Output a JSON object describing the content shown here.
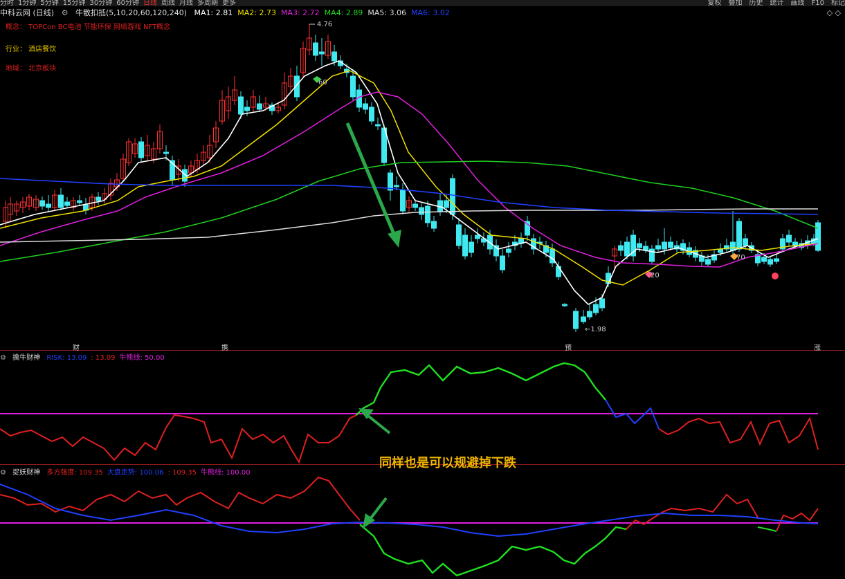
{
  "topbar": {
    "tabs": [
      "分时",
      "1分钟",
      "5分钟",
      "15分钟",
      "30分钟",
      "60分钟",
      "日线",
      "周线",
      "月线",
      "多周期",
      "更多"
    ],
    "active": "日线",
    "right": [
      "复权",
      "叠加",
      "历史",
      "统计",
      "画线",
      "F10",
      "标记"
    ]
  },
  "header": {
    "stock": "中科云网 (日线)",
    "indicator": "牛散扣抵(5,10,20,60,120,240)",
    "ma": [
      {
        "label": "MA1: 2.81",
        "color": "#ffffff"
      },
      {
        "label": "MA2: 2.73",
        "color": "#f0e000"
      },
      {
        "label": "MA3: 2.72",
        "color": "#e020e0"
      },
      {
        "label": "MA4: 2.89",
        "color": "#20d020"
      },
      {
        "label": "MA5: 3.06",
        "color": "#dddddd"
      },
      {
        "label": "MA6: 3.02",
        "color": "#2040ff"
      }
    ]
  },
  "info": {
    "concept": "概念： TOPCon BC电池 节能环保 网络游戏 NFT概念",
    "industry": "行业： 酒店餐饮",
    "region": "地域： 北京板块"
  },
  "price_labels": {
    "high": "4.76",
    "low": "1.98"
  },
  "annotations": {
    "n60": "60",
    "n20": "20",
    "n70": "70"
  },
  "markers": [
    {
      "text": "财",
      "color": "#4aa0ff"
    },
    {
      "text": "携",
      "color": "#ffcc66"
    },
    {
      "text": "预",
      "color": "#ffcc66"
    },
    {
      "text": "涨",
      "color": "#ffcc66"
    }
  ],
  "panel1": {
    "title": "擒牛财神",
    "items": [
      {
        "label": "RISK: 13.09",
        "color": "#2040ff"
      },
      {
        "label": ": 13.09",
        "color": "#e02020"
      },
      {
        "label": "牛熊线: 50.00",
        "color": "#e020e0"
      }
    ]
  },
  "panel2": {
    "title": "捉妖财神",
    "items": [
      {
        "label": "多方强度: 109.35",
        "color": "#e02020"
      },
      {
        "label": "大盘走势: 100.06",
        "color": "#2040ff"
      },
      {
        "label": ": 109.35",
        "color": "#e02020"
      },
      {
        "label": "牛熊线: 100.00",
        "color": "#e020e0"
      }
    ]
  },
  "caption": "同样也是可以规避掉下跌",
  "colors": {
    "up": "#ff3030",
    "down": "#40e8f0",
    "ma1": "#ffffff",
    "ma2": "#f0e000",
    "ma3": "#e020e0",
    "ma4": "#20d020",
    "ma5": "#dddddd",
    "ma6": "#2040ff",
    "arrow": "#2aa84a"
  }
}
